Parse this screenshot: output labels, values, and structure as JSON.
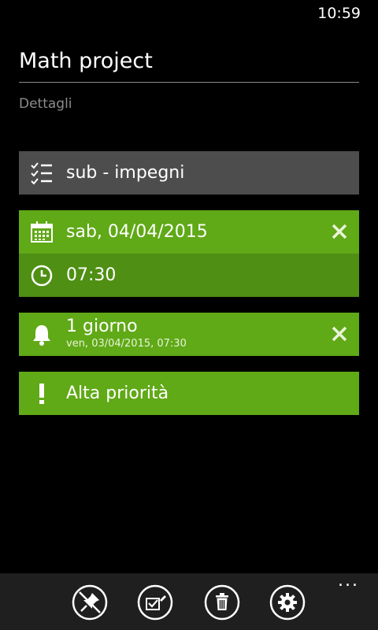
{
  "status": {
    "time": "10:59"
  },
  "task": {
    "title": "Math project",
    "details_placeholder": "Dettagli"
  },
  "tiles": {
    "subtasks": {
      "label": "sub - impegni",
      "icon": "checklist-icon"
    },
    "date": {
      "label": "sab, 04/04/2015",
      "icon": "calendar-icon"
    },
    "time": {
      "label": "07:30",
      "icon": "clock-icon"
    },
    "reminder": {
      "label": "1 giorno",
      "sublabel": "ven, 03/04/2015, 07:30",
      "icon": "bell-icon"
    },
    "priority": {
      "label": "Alta priorità",
      "icon": "exclamation-icon"
    }
  },
  "appbar": {
    "buttons": [
      "unpin",
      "mark-complete",
      "delete",
      "settings"
    ],
    "more": "..."
  },
  "colors": {
    "accent": "#60a917",
    "accent_dark": "#4f8f14",
    "neutral_tile": "#4d4d4d",
    "background": "#000000",
    "appbar": "#1f1f1f"
  }
}
